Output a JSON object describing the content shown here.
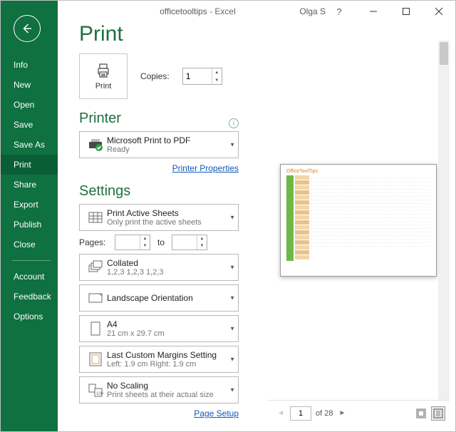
{
  "window": {
    "doc_name": "officetooltips",
    "app_name": "Excel",
    "user": "Olga S"
  },
  "sidebar": {
    "items": [
      {
        "label": "Info"
      },
      {
        "label": "New"
      },
      {
        "label": "Open"
      },
      {
        "label": "Save"
      },
      {
        "label": "Save As"
      },
      {
        "label": "Print"
      },
      {
        "label": "Share"
      },
      {
        "label": "Export"
      },
      {
        "label": "Publish"
      },
      {
        "label": "Close"
      }
    ],
    "footer": [
      {
        "label": "Account"
      },
      {
        "label": "Feedback"
      },
      {
        "label": "Options"
      }
    ]
  },
  "page": {
    "title": "Print",
    "print_button": "Print",
    "copies_label": "Copies:",
    "copies_value": "1"
  },
  "printer": {
    "header": "Printer",
    "name": "Microsoft Print to PDF",
    "status": "Ready",
    "properties_link": "Printer Properties"
  },
  "settings": {
    "header": "Settings",
    "pages_label": "Pages:",
    "pages_from": "",
    "pages_to_label": "to",
    "pages_to": "",
    "print_what": {
      "line1": "Print Active Sheets",
      "line2": "Only print the active sheets"
    },
    "collation": {
      "line1": "Collated",
      "line2": "1,2,3    1,2,3    1,2,3"
    },
    "orientation": {
      "line1": "Landscape Orientation",
      "line2": ""
    },
    "paper": {
      "line1": "A4",
      "line2": "21 cm x 29.7 cm"
    },
    "margins": {
      "line1": "Last Custom Margins Setting",
      "line2": "Left:  1.9 cm     Right:  1.9 cm"
    },
    "scaling": {
      "line1": "No Scaling",
      "line2": "Print sheets at their actual size"
    },
    "page_setup_link": "Page Setup"
  },
  "preview": {
    "thumb_title": "OfficeToolTips",
    "current_page": "1",
    "of_label": "of 28"
  }
}
